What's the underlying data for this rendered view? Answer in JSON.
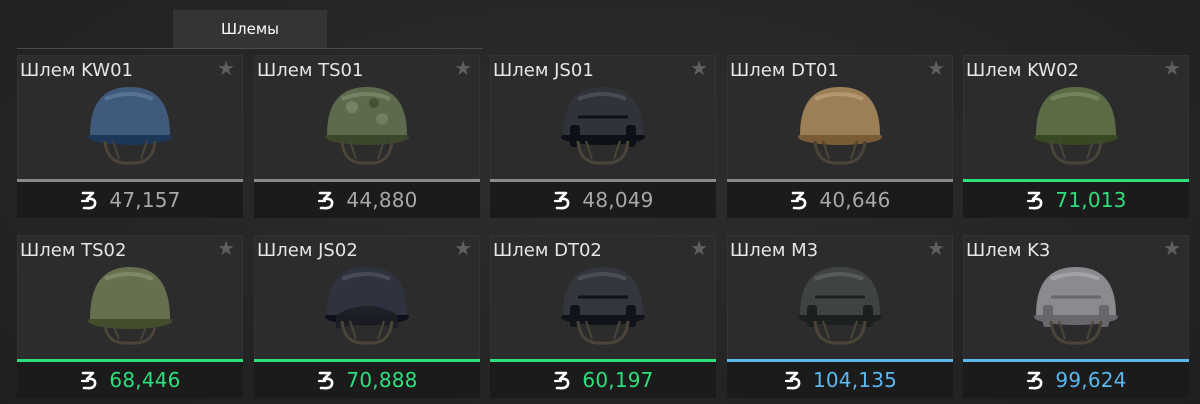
{
  "tab": {
    "label": "Шлемы"
  },
  "colors": {
    "common": "#a8a8a8",
    "uncommon": "#2ee07b",
    "rare": "#5ab8ef"
  },
  "items": [
    {
      "name": "Шлем KW01",
      "price": "47,157",
      "tier": "common",
      "color": "#3f5a7a",
      "style": "round",
      "icon": "star-icon"
    },
    {
      "name": "Шлем TS01",
      "price": "44,880",
      "tier": "common",
      "color": "#5d6a4e",
      "style": "camo",
      "icon": "star-icon"
    },
    {
      "name": "Шлем JS01",
      "price": "48,049",
      "tier": "common",
      "color": "#30333a",
      "style": "tactical",
      "icon": "star-icon"
    },
    {
      "name": "Шлем DT01",
      "price": "40,646",
      "tier": "common",
      "color": "#9c7f57",
      "style": "round",
      "icon": "star-icon"
    },
    {
      "name": "Шлем KW02",
      "price": "71,013",
      "tier": "uncommon",
      "color": "#5a6b45",
      "style": "round",
      "icon": "star-icon"
    },
    {
      "name": "Шлем TS02",
      "price": "68,446",
      "tier": "uncommon",
      "color": "#66704f",
      "style": "side",
      "icon": "star-icon"
    },
    {
      "name": "Шлем JS02",
      "price": "70,888",
      "tier": "uncommon",
      "color": "#2f3340",
      "style": "visor",
      "icon": "star-icon"
    },
    {
      "name": "Шлем DT02",
      "price": "60,197",
      "tier": "uncommon",
      "color": "#33363c",
      "style": "tactical",
      "icon": "star-icon"
    },
    {
      "name": "Шлем M3",
      "price": "104,135",
      "tier": "rare",
      "color": "#3f4443",
      "style": "fast",
      "icon": "star-icon"
    },
    {
      "name": "Шлем K3",
      "price": "99,624",
      "tier": "rare",
      "color": "#8c8a8e",
      "style": "fast",
      "icon": "star-icon"
    }
  ]
}
